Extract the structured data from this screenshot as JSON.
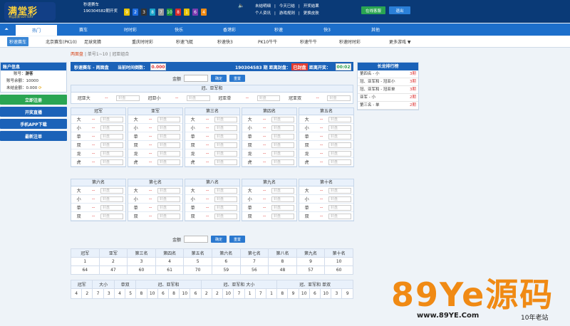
{
  "header": {
    "logo_text": "满堂彩",
    "logo_sub": "幸运彩票 LOTTERY",
    "game_name": "秒速赛车",
    "period_label": "190304582期开奖",
    "balls": [
      {
        "n": "9",
        "c": "#e5c100"
      },
      {
        "n": "2",
        "c": "#1f6de0"
      },
      {
        "n": "3",
        "c": "#333333"
      },
      {
        "n": "8",
        "c": "#1aa3c9"
      },
      {
        "n": "7",
        "c": "#9a9a9a"
      },
      {
        "n": "10",
        "c": "#1e9a3c"
      },
      {
        "n": "8",
        "c": "#d92a2a"
      },
      {
        "n": "1",
        "c": "#e5c100"
      },
      {
        "n": "6",
        "c": "#7a3bb0"
      },
      {
        "n": "4",
        "c": "#f08a14"
      }
    ],
    "links_row1": [
      "未结明细",
      "|",
      "今天已结",
      "|",
      "开奖结果"
    ],
    "links_row2": [
      "个人资讯",
      "|",
      "游戏规则",
      "|",
      "更换皮肤"
    ],
    "service_btn": "在线客服",
    "logout_btn": "退出"
  },
  "nav": {
    "arrow": "⏶",
    "tabs": [
      "热门",
      "赛车",
      "时时彩",
      "快乐",
      "香港彩",
      "秒速",
      "快3",
      "其他"
    ]
  },
  "subnav": [
    "秒速赛车",
    "北京赛车(PK10)",
    "足球竞猜",
    "重庆时时彩",
    "秒速飞艇",
    "秒速快3",
    "PK10牛牛",
    "秒速牛牛",
    "秒速时时彩",
    "更多游戏 ▼"
  ],
  "crumbs": {
    "active": "两面盘",
    "sep": "|",
    "b": "单号1~10",
    "c": "冠亚组合"
  },
  "account": {
    "title": "账户信息",
    "user_label": "账号：",
    "user": "游客",
    "balance_label": "账号余额：",
    "balance": "10000",
    "unsettled_label": "未结金额：",
    "unsettled": "0.000"
  },
  "side_buttons": [
    "立即注册",
    "开奖直播",
    "手机APP下载",
    "最新注单"
  ],
  "bar": {
    "game": "秒速赛车 - 两面盘",
    "close_label": "当前时间倒数：",
    "close_val": "0.000",
    "period": "190304583 期 距离封盘：",
    "seal": "已封盘",
    "draw_label": "距离开奖：",
    "draw": "00:02"
  },
  "amount": {
    "label": "金额",
    "confirm": "确定",
    "reset": "重置"
  },
  "gy": {
    "title": "冠、亚军和",
    "cells": [
      {
        "n": "冠亚大",
        "o": "--"
      },
      {
        "n": "冠亚小",
        "o": "--"
      },
      {
        "n": "冠亚单",
        "o": "--"
      },
      {
        "n": "冠亚双",
        "o": "--"
      }
    ],
    "sealed": "封盘"
  },
  "groups1": [
    {
      "t": "冠军",
      "r": [
        "大",
        "小",
        "单",
        "双",
        "龙",
        "虎"
      ]
    },
    {
      "t": "亚军",
      "r": [
        "大",
        "小",
        "单",
        "双",
        "龙",
        "虎"
      ]
    },
    {
      "t": "第三名",
      "r": [
        "大",
        "小",
        "单",
        "双",
        "龙",
        "虎"
      ]
    },
    {
      "t": "第四名",
      "r": [
        "大",
        "小",
        "单",
        "双",
        "龙",
        "虎"
      ]
    },
    {
      "t": "第五名",
      "r": [
        "大",
        "小",
        "单",
        "双",
        "龙",
        "虎"
      ]
    }
  ],
  "groups2": [
    {
      "t": "第六名",
      "r": [
        "大",
        "小",
        "单",
        "双"
      ]
    },
    {
      "t": "第七名",
      "r": [
        "大",
        "小",
        "单",
        "双"
      ]
    },
    {
      "t": "第八名",
      "r": [
        "大",
        "小",
        "单",
        "双"
      ]
    },
    {
      "t": "第九名",
      "r": [
        "大",
        "小",
        "单",
        "双"
      ]
    },
    {
      "t": "第十名",
      "r": [
        "大",
        "小",
        "单",
        "双"
      ]
    }
  ],
  "odds": "--",
  "sealed": "封盘",
  "long": {
    "title": "长龙排行榜",
    "rows": [
      {
        "k": "第四名 - 小",
        "v": "3期"
      },
      {
        "k": "冠、亚军和 - 冠亚小",
        "v": "3期"
      },
      {
        "k": "冠、亚军和 - 冠亚单",
        "v": "3期"
      },
      {
        "k": "亚军 - 小",
        "v": "2期"
      },
      {
        "k": "第三名 - 单",
        "v": "2期"
      }
    ]
  },
  "stats": {
    "heads": [
      "冠军",
      "亚军",
      "第三名",
      "第四名",
      "第五名",
      "第六名",
      "第七名",
      "第八名",
      "第九名",
      "第十名"
    ],
    "nums": [
      "1",
      "2",
      "3",
      "4",
      "5",
      "6",
      "7",
      "8",
      "9",
      "10"
    ],
    "counts": [
      "64",
      "47",
      "60",
      "61",
      "70",
      "59",
      "56",
      "48",
      "57",
      "60"
    ]
  },
  "road": {
    "heads": [
      "冠军",
      "大小",
      "单双",
      "冠、亚军和",
      "冠、亚军和 大小",
      "冠、亚军和 单双"
    ],
    "vals": [
      "4",
      "2",
      "7",
      "3",
      "4",
      "5",
      "8",
      "10",
      "6",
      "8",
      "10",
      "6",
      "2",
      "2",
      "10",
      "7",
      "1",
      "7",
      "1",
      "8",
      "9",
      "10",
      "6",
      "10",
      "3",
      "9"
    ]
  },
  "watermark": {
    "big": "89Ye源码",
    "url": "www.89YE.Com",
    "old": "10年老站"
  }
}
